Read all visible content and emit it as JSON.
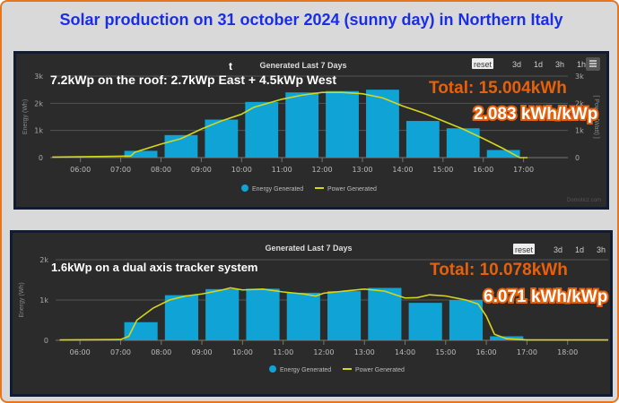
{
  "title": "Solar production on 31 october 2024 (sunny day) in Northern Italy",
  "colors": {
    "energy": "#10a4d6",
    "power": "#d6d61a",
    "total": "#e8600a"
  },
  "chart_data": [
    {
      "type": "bar",
      "title": "Generated Last 7 Days",
      "title_prefix": "t",
      "buttons": [
        "reset",
        "3d",
        "1d",
        "3h",
        "1h"
      ],
      "menu_icon": "hamburger-icon",
      "note": "7.2kWp on the roof: 2.7kWp East + 4.5kWp West",
      "total": "Total: 15.004kWh",
      "specific": "2.083 kWh/kWp",
      "ylabel": "Energy (Wh)",
      "y2label": "[ Power (Watt) ]",
      "ylim": [
        0,
        3000
      ],
      "yticks": [
        "0",
        "1k",
        "2k",
        "3k"
      ],
      "y2ticks": [
        "0",
        "1k",
        "2k",
        "3k"
      ],
      "xlim": [
        5.25,
        18.1
      ],
      "xticks": [
        "06:00",
        "07:00",
        "08:00",
        "09:00",
        "10:00",
        "11:00",
        "12:00",
        "13:00",
        "14:00",
        "15:00",
        "16:00",
        "17:00"
      ],
      "credit": "Domoticz.com",
      "legend": [
        "Energy Generated",
        "Power Generated"
      ],
      "series": [
        {
          "name": "Energy Generated",
          "type": "bar",
          "x": [
            7,
            8,
            9,
            10,
            11,
            12,
            13,
            14,
            15,
            16
          ],
          "values": [
            250,
            830,
            1400,
            2050,
            2400,
            2450,
            2500,
            1350,
            1080,
            280
          ]
        },
        {
          "name": "Power Generated",
          "type": "line",
          "x": [
            5.3,
            7.0,
            7.25,
            7.35,
            8,
            8.5,
            9,
            9.5,
            10,
            10.3,
            11,
            11.5,
            12,
            12.5,
            13,
            13.5,
            14,
            14.5,
            15,
            15.5,
            16,
            16.5,
            16.9,
            17.1
          ],
          "values": [
            20,
            50,
            60,
            200,
            500,
            700,
            1050,
            1350,
            1600,
            1850,
            2150,
            2300,
            2400,
            2400,
            2350,
            2200,
            1900,
            1650,
            1350,
            1050,
            700,
            330,
            0,
            0
          ]
        }
      ]
    },
    {
      "type": "bar",
      "title": "Generated Last 7 Days",
      "title_prefix": "",
      "buttons": [
        "reset",
        "3d",
        "1d",
        "3h"
      ],
      "note": "1.6kWp on a dual axis tracker system",
      "total": "Total: 10.078kWh",
      "specific": "6.071 kWh/kWp",
      "ylabel": "Energy (Wh)",
      "ylim": [
        0,
        2000
      ],
      "yticks": [
        "0",
        "1k",
        "2k"
      ],
      "xlim": [
        5.4,
        19.0
      ],
      "xticks": [
        "06:00",
        "07:00",
        "08:00",
        "09:00",
        "10:00",
        "11:00",
        "12:00",
        "13:00",
        "14:00",
        "15:00",
        "16:00",
        "17:00",
        "18:00"
      ],
      "legend": [
        "Energy Generated",
        "Power Generated"
      ],
      "series": [
        {
          "name": "Energy Generated",
          "type": "bar",
          "x": [
            7,
            8,
            9,
            10,
            11,
            12,
            13,
            14,
            15,
            16
          ],
          "values": [
            450,
            1120,
            1270,
            1280,
            1180,
            1220,
            1300,
            930,
            1000,
            100
          ]
        },
        {
          "name": "Power Generated",
          "type": "line",
          "x": [
            5.5,
            7.0,
            7.2,
            7.4,
            7.8,
            8.2,
            8.6,
            9,
            9.5,
            9.7,
            10,
            10.5,
            11,
            11.5,
            11.8,
            12,
            12.5,
            13,
            13.5,
            14,
            14.3,
            14.6,
            15,
            15.5,
            15.8,
            16,
            16.2,
            16.5,
            17,
            19
          ],
          "values": [
            10,
            20,
            100,
            500,
            800,
            1000,
            1100,
            1150,
            1250,
            1300,
            1250,
            1270,
            1200,
            1150,
            1100,
            1170,
            1220,
            1270,
            1220,
            1050,
            1060,
            1130,
            1100,
            1000,
            900,
            600,
            150,
            40,
            10,
            10
          ]
        }
      ]
    }
  ]
}
